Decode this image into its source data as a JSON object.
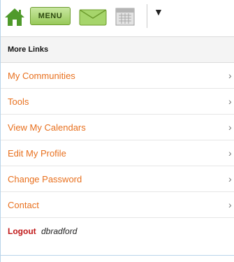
{
  "toolbar": {
    "home_icon": "home-icon",
    "menu_label": "MENU",
    "mail_icon": "mail-icon",
    "calendar_icon": "calendar-icon",
    "dropdown_icon": "▼",
    "brand_color": "#4f9a2b"
  },
  "section": {
    "title": "More Links"
  },
  "links": [
    {
      "label": "My Communities",
      "chevron": "›"
    },
    {
      "label": "Tools",
      "chevron": "›"
    },
    {
      "label": "View My Calendars",
      "chevron": "›"
    },
    {
      "label": "Edit My Profile",
      "chevron": "›"
    },
    {
      "label": "Change Password",
      "chevron": "›"
    },
    {
      "label": "Contact",
      "chevron": "›"
    }
  ],
  "logout": {
    "label": "Logout",
    "username": "dbradford"
  },
  "colors": {
    "link": "#e8701e",
    "logout": "#c01818",
    "header_bg": "#f4f4f4"
  }
}
